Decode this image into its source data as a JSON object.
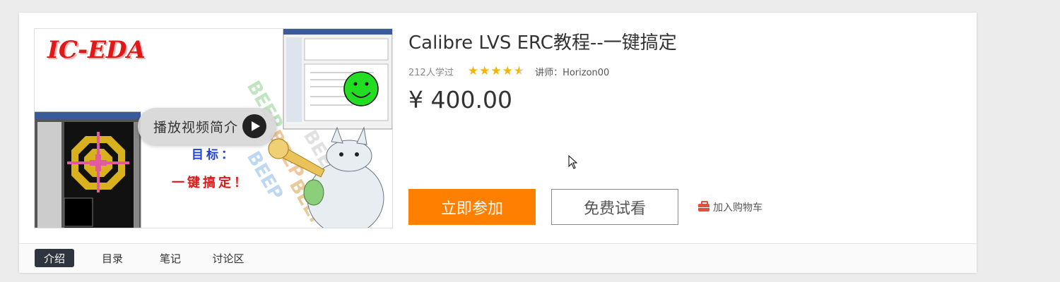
{
  "course": {
    "title": "Calibre LVS ERC教程--一键搞定",
    "learners": "212人学过",
    "rating": 4.5,
    "teacher": "讲师：Horizon00",
    "price": "¥ 400.00"
  },
  "thumbnail": {
    "logo_text": "IC-EDA",
    "overlay_text_1": "目标：",
    "overlay_text_2": "一键搞定！",
    "play_label": "播放视频简介"
  },
  "actions": {
    "join_label": "立即参加",
    "trial_label": "免费试看",
    "cart_label": "加入购物车"
  },
  "tabs": [
    {
      "label": "介绍",
      "active": true
    },
    {
      "label": "目录",
      "active": false
    },
    {
      "label": "笔记",
      "active": false
    },
    {
      "label": "讨论区",
      "active": false
    }
  ],
  "colors": {
    "accent": "#ff7f00",
    "star": "#f5b400",
    "tab_active": "#2f3540",
    "cart_icon": "#e74c3c"
  }
}
